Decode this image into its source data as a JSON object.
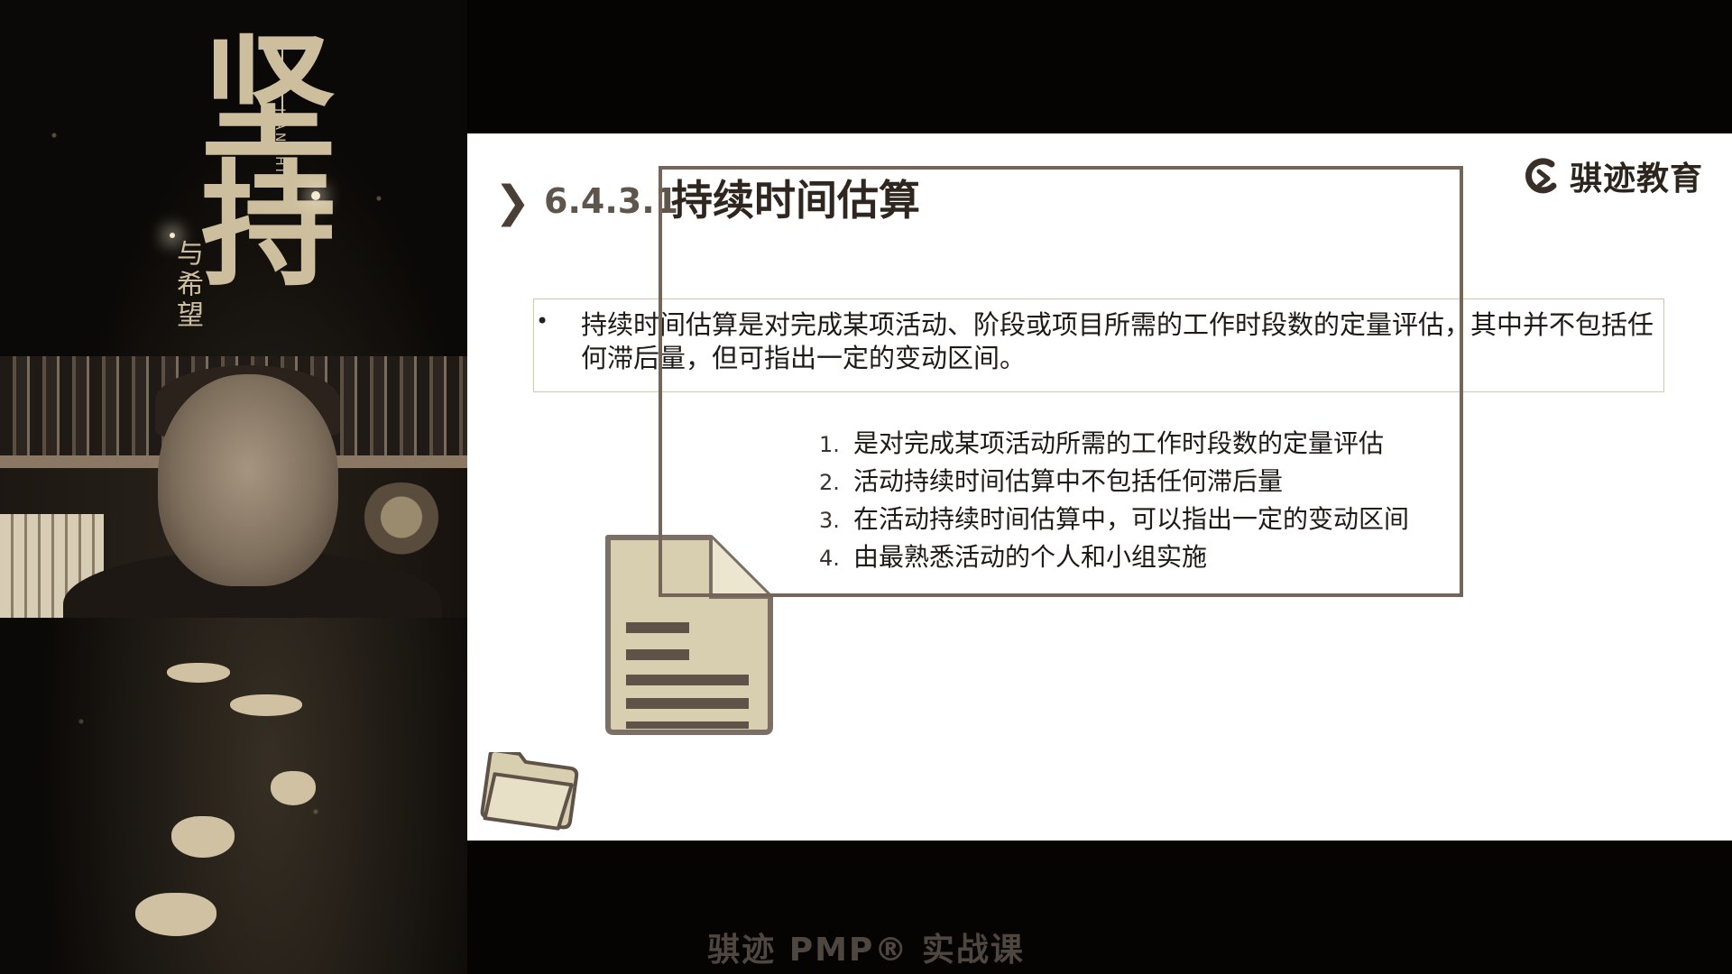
{
  "banner": {
    "title": "坚持",
    "subtitle": "与希望",
    "pinyin": "JIANCHI"
  },
  "slide": {
    "section_number": "6.4.3.1",
    "title": "持续时间估算",
    "brand_name": "骐迹教育",
    "definition": "持续时间估算是对完成某项活动、阶段或项目所需的工作时段数的定量评估，其中并不包括任何滞后量，但可指出一定的变动区间。",
    "bullet": "•",
    "points": [
      {
        "num": "1.",
        "text": "是对完成某项活动所需的工作时段数的定量评估"
      },
      {
        "num": "2.",
        "text": "活动持续时间估算中不包括任何滞后量"
      },
      {
        "num": "3.",
        "text": "在活动持续时间估算中，可以指出一定的变动区间"
      },
      {
        "num": "4.",
        "text": "由最熟悉活动的个人和小组实施"
      }
    ]
  },
  "footer": {
    "title": "骐迹 PMP® 实战课"
  },
  "icons": {
    "title_marker": "chevron-right-icon",
    "brand": "brand-logo-icon",
    "document": "document-icon",
    "folder": "folder-icon"
  },
  "colors": {
    "slide_bg": "#ffffff",
    "frame": "#74645a",
    "accent_tan": "#d8cfb0",
    "text_dark": "#1e1a16"
  }
}
